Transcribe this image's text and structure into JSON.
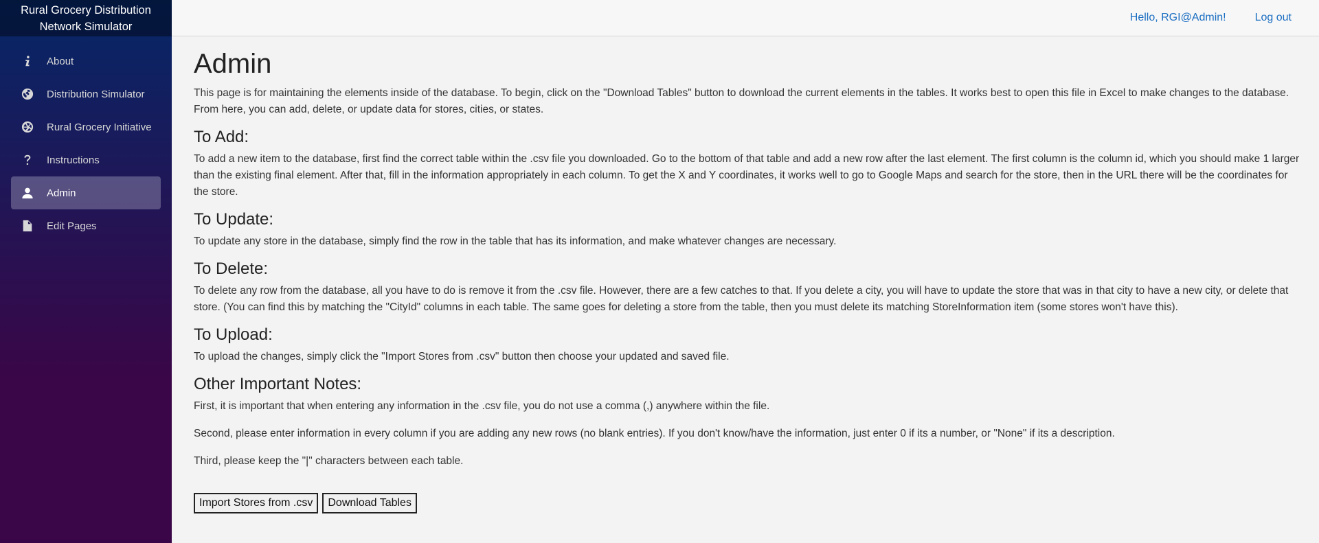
{
  "sidebar": {
    "brand": "Rural Grocery Distribution Network Simulator",
    "items": [
      {
        "label": "About",
        "icon": "info-icon"
      },
      {
        "label": "Distribution Simulator",
        "icon": "globe-icon"
      },
      {
        "label": "Rural Grocery Initiative",
        "icon": "aperture-icon"
      },
      {
        "label": "Instructions",
        "icon": "question-icon"
      },
      {
        "label": "Admin",
        "icon": "person-icon"
      },
      {
        "label": "Edit Pages",
        "icon": "document-icon"
      }
    ],
    "active_index": 4
  },
  "header": {
    "greeting": "Hello, RGI@Admin!",
    "logout": "Log out"
  },
  "main": {
    "title": "Admin",
    "intro": "This page is for maintaining the elements inside of the database. To begin, click on the \"Download Tables\" button to download the current elements in the tables. It works best to open this file in Excel to make changes to the database. From here, you can add, delete, or update data for stores, cities, or states.",
    "sections": [
      {
        "heading": "To Add:",
        "text": "To add a new item to the database, first find the correct table within the .csv file you downloaded. Go to the bottom of that table and add a new row after the last element. The first column is the column id, which you should make 1 larger than the existing final element. After that, fill in the information appropriately in each column. To get the X and Y coordinates, it works well to go to Google Maps and search for the store, then in the URL there will be the coordinates for the store."
      },
      {
        "heading": "To Update:",
        "text": "To update any store in the database, simply find the row in the table that has its information, and make whatever changes are necessary."
      },
      {
        "heading": "To Delete:",
        "text": "To delete any row from the database, all you have to do is remove it from the .csv file. However, there are a few catches to that. If you delete a city, you will have to update the store that was in that city to have a new city, or delete that store. (You can find this by matching the \"CityId\" columns in each table. The same goes for deleting a store from the table, then you must delete its matching StoreInformation item (some stores won't have this)."
      },
      {
        "heading": "To Upload:",
        "text": "To upload the changes, simply click the \"Import Stores from .csv\" button then choose your updated and saved file."
      }
    ],
    "notes_heading": "Other Important Notes:",
    "notes": [
      "First, it is important that when entering any information in the .csv file, you do not use a comma (,) anywhere within the file.",
      "Second, please enter information in every column if you are adding any new rows (no blank entries). If you don't know/have the information, just enter 0 if its a number, or \"None\" if its a description.",
      "Third, please keep the \"|\" characters between each table."
    ],
    "buttons": {
      "import": "Import Stores from .csv",
      "download": "Download Tables"
    }
  },
  "colors": {
    "sidebar_top": "#052767",
    "sidebar_bottom": "#3a0647",
    "link": "#1b6ec2"
  }
}
